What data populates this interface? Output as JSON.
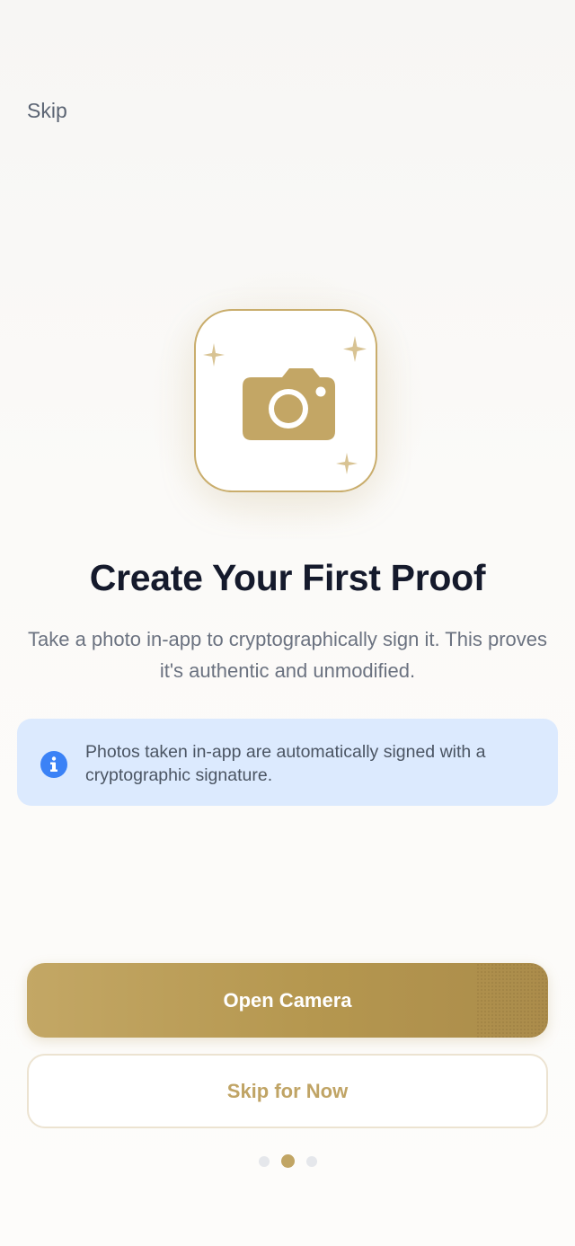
{
  "header": {
    "skip_label": "Skip"
  },
  "hero": {
    "icon": "camera-icon",
    "decorations": "sparkle-icon",
    "accent_color": "#c9ad6c"
  },
  "content": {
    "title": "Create Your First Proof",
    "subtitle": "Take a photo in-app to cryptographically sign it. This proves it's authentic and unmodified."
  },
  "info_box": {
    "icon": "info-icon",
    "icon_color": "#3b82f6",
    "background_color": "#dceafe",
    "text": "Photos taken in-app are automatically signed with a cryptographic signature."
  },
  "actions": {
    "primary_label": "Open Camera",
    "secondary_label": "Skip for Now"
  },
  "pager": {
    "total_pages": 3,
    "current_page": 2
  }
}
